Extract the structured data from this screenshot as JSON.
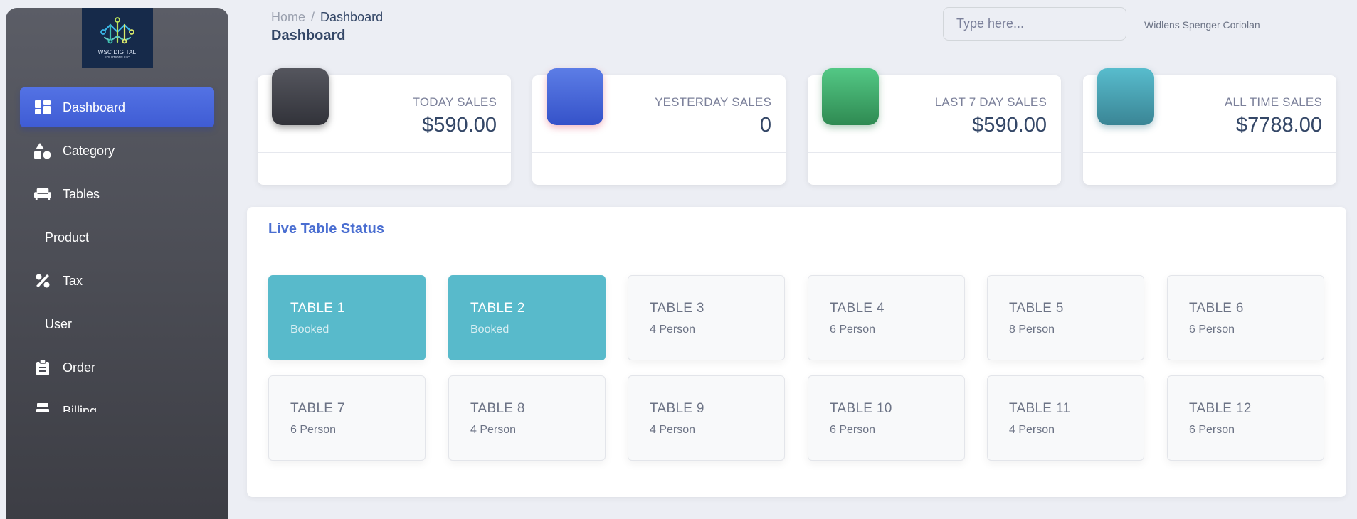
{
  "brand": {
    "logo_text": "WSC DIGITAL",
    "logo_sub": "SOLUTIONS LLC"
  },
  "sidebar": {
    "items": [
      {
        "label": "Dashboard",
        "icon": "dashboard-icon",
        "active": true
      },
      {
        "label": "Category",
        "icon": "shapes-icon"
      },
      {
        "label": "Tables",
        "icon": "couch-icon"
      },
      {
        "label": "Product",
        "icon": ""
      },
      {
        "label": "Tax",
        "icon": "percent-icon"
      },
      {
        "label": "User",
        "icon": ""
      },
      {
        "label": "Order",
        "icon": "clipboard-icon"
      },
      {
        "label": "Billing",
        "icon": "cash-register-icon"
      }
    ]
  },
  "header": {
    "breadcrumb_home": "Home",
    "breadcrumb_separator": "/",
    "breadcrumb_current": "Dashboard",
    "title": "Dashboard",
    "search_placeholder": "Type here...",
    "user_name": "Widlens Spenger Coriolan"
  },
  "stats": [
    {
      "label": "TODAY SALES",
      "value": "$590.00",
      "color": "#3e3f46"
    },
    {
      "label": "YESTERDAY SALES",
      "value": "0",
      "color": "#3f5fd1"
    },
    {
      "label": "LAST 7 DAY SALES",
      "value": "$590.00",
      "color": "#3ea566"
    },
    {
      "label": "ALL TIME SALES",
      "value": "$7788.00",
      "color": "#4aa3b4"
    }
  ],
  "live_tables": {
    "title": "Live Table Status",
    "tables": [
      {
        "name": "TABLE 1",
        "status": "Booked",
        "booked": true
      },
      {
        "name": "TABLE 2",
        "status": "Booked",
        "booked": true
      },
      {
        "name": "TABLE 3",
        "status": "4 Person",
        "booked": false
      },
      {
        "name": "TABLE 4",
        "status": "6 Person",
        "booked": false
      },
      {
        "name": "TABLE 5",
        "status": "8 Person",
        "booked": false
      },
      {
        "name": "TABLE 6",
        "status": "6 Person",
        "booked": false
      },
      {
        "name": "TABLE 7",
        "status": "6 Person",
        "booked": false
      },
      {
        "name": "TABLE 8",
        "status": "4 Person",
        "booked": false
      },
      {
        "name": "TABLE 9",
        "status": "4 Person",
        "booked": false
      },
      {
        "name": "TABLE 10",
        "status": "6 Person",
        "booked": false
      },
      {
        "name": "TABLE 11",
        "status": "4 Person",
        "booked": false
      },
      {
        "name": "TABLE 12",
        "status": "6 Person",
        "booked": false
      }
    ]
  },
  "colors": {
    "accent": "#4a6ed1",
    "booked": "#58bacb",
    "sidebar_active": "#4a66d9"
  }
}
